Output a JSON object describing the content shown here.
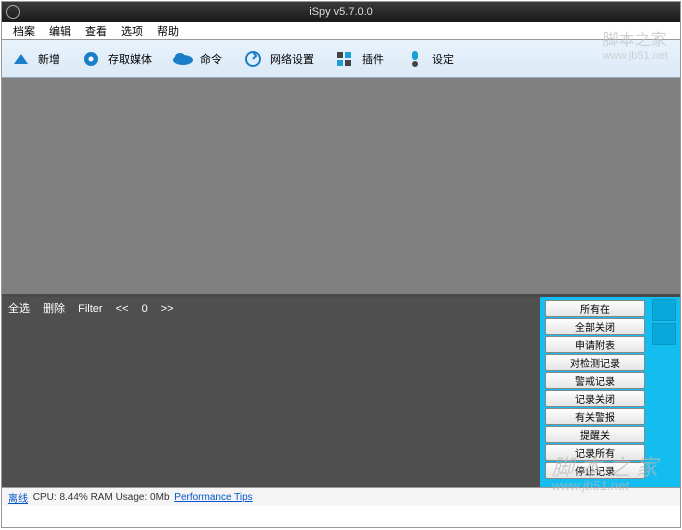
{
  "title": "iSpy v5.7.0.0",
  "menu": {
    "file": "档案",
    "edit": "编辑",
    "view": "查看",
    "options": "选项",
    "help": "帮助"
  },
  "toolbar": {
    "new": "新增",
    "media": "存取媒体",
    "command": "命令",
    "web": "网络设置",
    "plugin": "插件",
    "settings": "设定"
  },
  "lower": {
    "selectall": "全选",
    "delete": "删除",
    "filter": "Filter",
    "prev": "<<",
    "count": "0",
    "next": ">>"
  },
  "side": {
    "b0": "所有在",
    "b1": "全部关闭",
    "b2": "申请附表",
    "b3": "对检测记录",
    "b4": "警戒记录",
    "b5": "记录关闭",
    "b6": "有关警报",
    "b7": "提醒关",
    "b8": "记录所有",
    "b9": "停止记录"
  },
  "status": {
    "offline": "离线",
    "cpu": "CPU: 8.44% RAM Usage: 0Mb",
    "tips": "Performance Tips"
  },
  "watermark": {
    "top1": "脚本之家",
    "top2": "www.jb51.net",
    "bot1": "脚 本 之 家",
    "bot2": "www.jb51.net"
  }
}
